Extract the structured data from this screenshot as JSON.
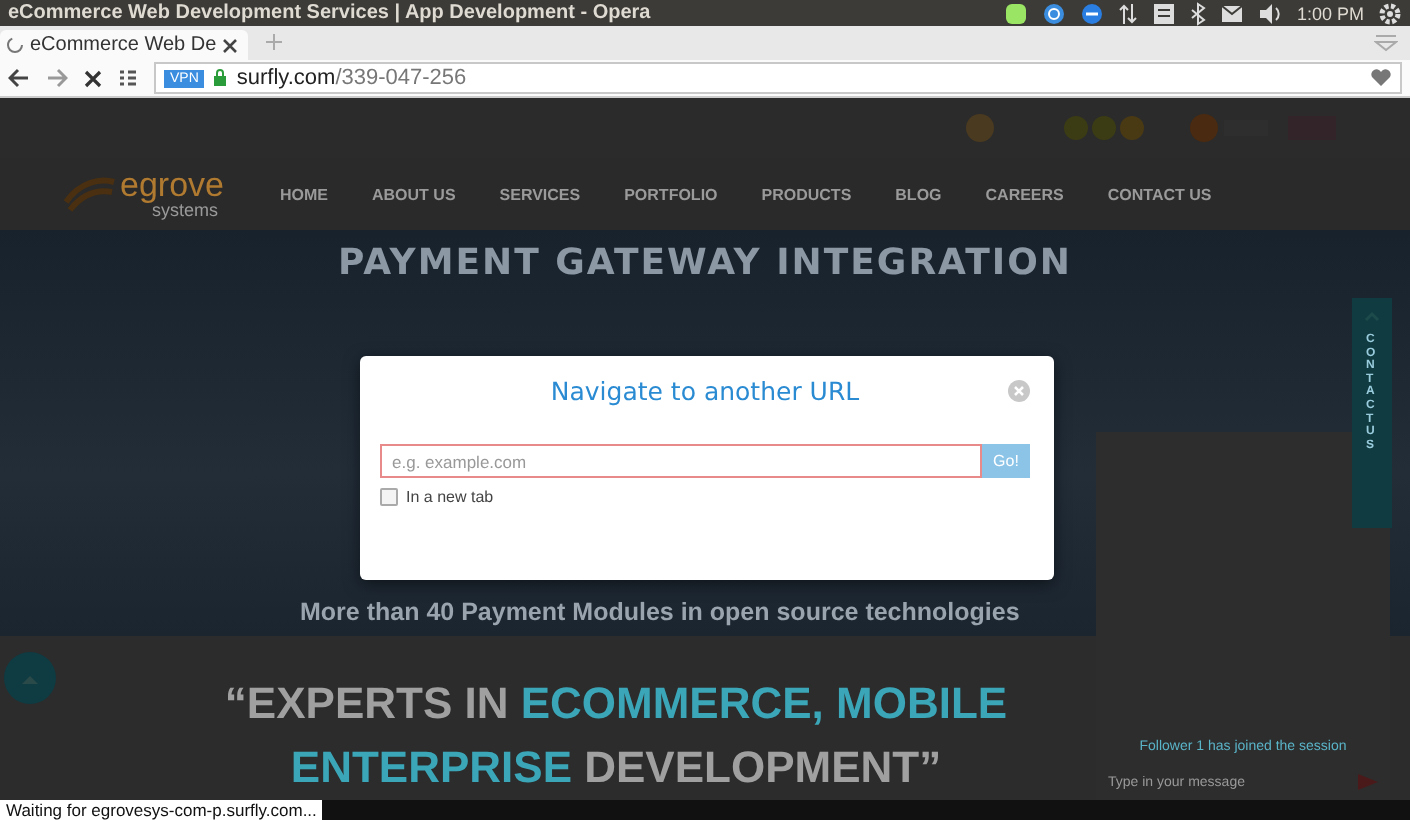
{
  "window": {
    "title": "eCommerce Web Development Services | App Development - Opera",
    "clock": "1:00 PM"
  },
  "tabs": [
    {
      "label": "eCommerce Web De",
      "selected": true
    }
  ],
  "address_bar": {
    "badge": "VPN",
    "host": "surfly.com",
    "path": "/339-047-256"
  },
  "site": {
    "nav": [
      "HOME",
      "ABOUT US",
      "SERVICES",
      "PORTFOLIO",
      "PRODUCTS",
      "BLOG",
      "CAREERS",
      "CONTACT US"
    ],
    "logo": {
      "big": "egrove",
      "small": "systems"
    },
    "hero_title": "PAYMENT GATEWAY INTEGRATION",
    "hero_subtitle": "More than 40 Payment Modules in open source technologies",
    "tagline_lines": [
      [
        {
          "text": "“EXPERTS IN ",
          "accent": false
        },
        {
          "text": "ECOMMERCE, MOBILE",
          "accent": true
        }
      ],
      [
        {
          "text": "ENTERPRISE",
          "accent": true
        },
        {
          "text": " DEVELOPMENT”",
          "accent": false
        }
      ]
    ],
    "side_tab": "CONTACT US"
  },
  "chat": {
    "notice": "Follower 1 has joined the session",
    "placeholder": "Type in your message"
  },
  "dialog": {
    "title": "Navigate to another URL",
    "placeholder": "e.g. example.com",
    "go": "Go!",
    "new_tab": {
      "label": "In a new tab",
      "checked": false
    }
  },
  "status_bar": "Waiting for egrovesys-com-p.surfly.com..."
}
